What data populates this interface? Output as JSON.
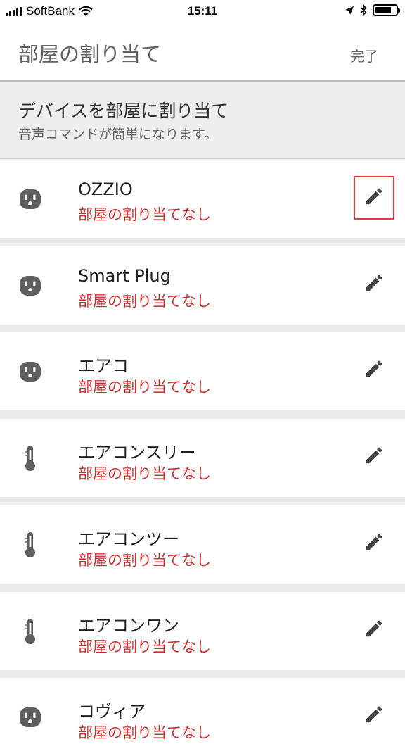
{
  "status_bar": {
    "carrier": "SoftBank",
    "time": "15:11",
    "battery_level": 0.8
  },
  "header": {
    "title": "部屋の割り当て",
    "done_label": "完了"
  },
  "banner": {
    "title": "デバイスを部屋に割り当て",
    "subtitle": "音声コマンドが簡単になります。"
  },
  "devices": [
    {
      "name": "OZZIO",
      "room_status": "部屋の割り当てなし",
      "icon": "outlet-icon",
      "selected": true
    },
    {
      "name": "Smart Plug",
      "room_status": "部屋の割り当てなし",
      "icon": "outlet-icon",
      "selected": false
    },
    {
      "name": "エアコ",
      "room_status": "部屋の割り当てなし",
      "icon": "outlet-icon",
      "selected": false
    },
    {
      "name": "エアコンスリー",
      "room_status": "部屋の割り当てなし",
      "icon": "thermometer-icon",
      "selected": false
    },
    {
      "name": "エアコンツー",
      "room_status": "部屋の割り当てなし",
      "icon": "thermometer-icon",
      "selected": false
    },
    {
      "name": "エアコンワン",
      "room_status": "部屋の割り当てなし",
      "icon": "thermometer-icon",
      "selected": false
    },
    {
      "name": "コヴィア",
      "room_status": "部屋の割り当てなし",
      "icon": "outlet-icon",
      "selected": false
    }
  ],
  "colors": {
    "room_status": "#d32f2f",
    "icon": "#5f5f5f",
    "highlight": "#e53935"
  }
}
